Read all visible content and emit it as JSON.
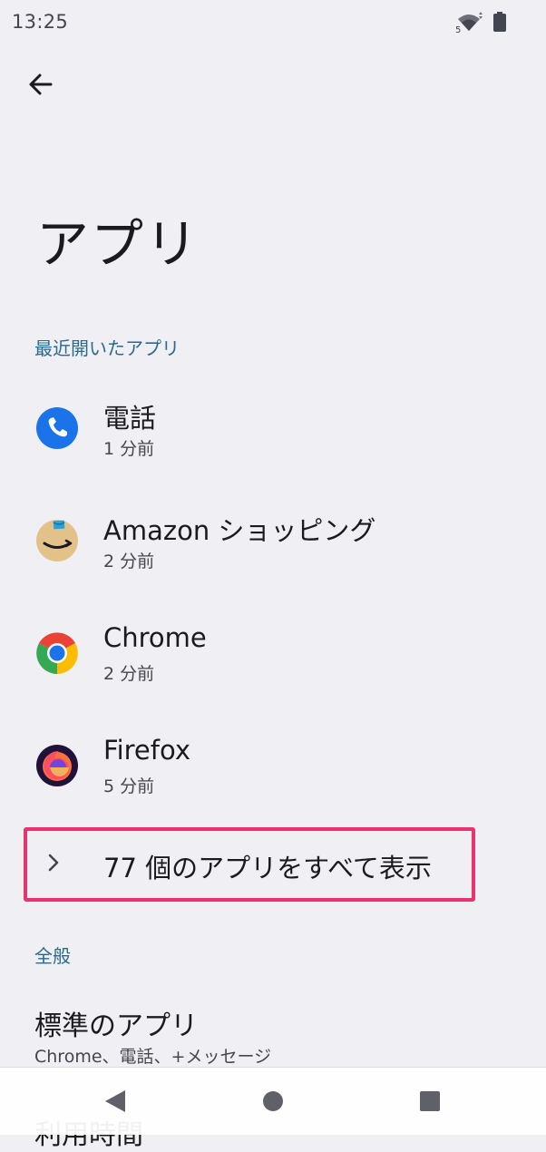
{
  "status_bar": {
    "time": "13:25",
    "wifi_badge": "5",
    "icons": [
      "wifi-icon",
      "battery-icon"
    ]
  },
  "header": {
    "back_icon": "arrow-back-icon",
    "title": "アプリ"
  },
  "recent_apps": {
    "section_label": "最近開いたアプリ",
    "items": [
      {
        "name": "電話",
        "time": "1 分前",
        "icon": "phone-app-icon"
      },
      {
        "name": "Amazon ショッピング",
        "time": "2 分前",
        "icon": "amazon-app-icon"
      },
      {
        "name": "Chrome",
        "time": "2 分前",
        "icon": "chrome-app-icon"
      },
      {
        "name": "Firefox",
        "time": "5 分前",
        "icon": "firefox-app-icon"
      }
    ],
    "see_all_label": "77 個のアプリをすべて表示",
    "highlight_color": "#e8336f"
  },
  "general": {
    "section_label": "全般",
    "default_apps_title": "標準のアプリ",
    "default_apps_summary": "Chrome、電話、+メッセージ",
    "next_item_partial": "利用時間"
  },
  "nav_bar": {
    "icons": [
      "nav-back-icon",
      "nav-home-icon",
      "nav-recents-icon"
    ]
  },
  "colors": {
    "background": "#f0eff4",
    "accent_text": "#2a6a8c"
  }
}
